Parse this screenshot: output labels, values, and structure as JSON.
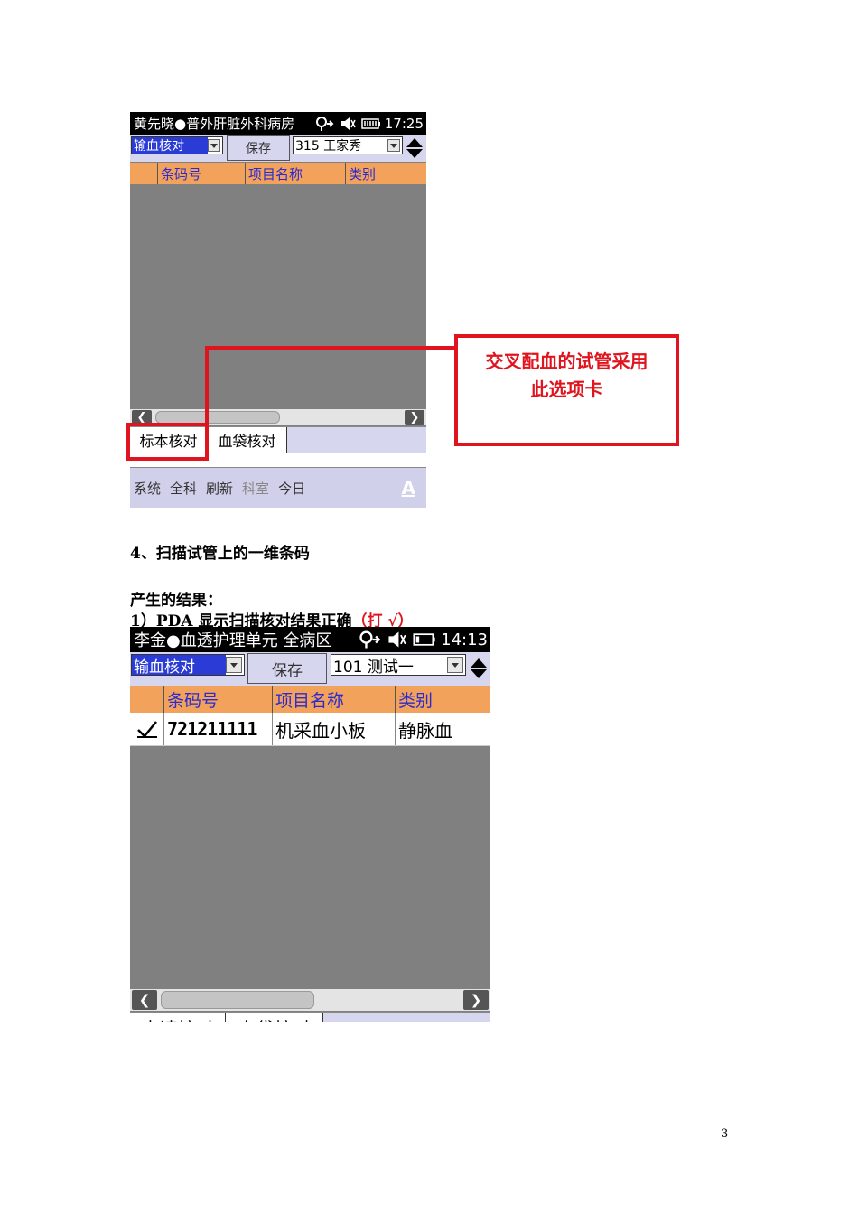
{
  "screen1": {
    "status": {
      "title": "黄先晓●普外肝脏外科病房",
      "time": "17:25"
    },
    "toolbar": {
      "dropdown_label": "输血核对",
      "save_label": "保存",
      "patient_select": "315 王家秀"
    },
    "table": {
      "headers": [
        "条码号",
        "项目名称",
        "类别"
      ]
    },
    "tabs": [
      "标本核对",
      "血袋核对"
    ],
    "menu": [
      "系统",
      "全科",
      "刷新",
      "科室",
      "今日"
    ],
    "menu_disabled": [
      "科室"
    ],
    "keyboard_glyph": "A"
  },
  "callout": {
    "line1": "交叉配血的试管采用",
    "line2": "此选项卡"
  },
  "doc": {
    "step_heading": "4、扫描试管上的一维条码",
    "result_heading": "产生的结果：",
    "result_item_prefix": "1）PDA 显示扫描核对结果正确",
    "result_item_mark": "（打 √）"
  },
  "screen2": {
    "status": {
      "title": "李金●血透护理单元 全病区",
      "time": "14:13"
    },
    "toolbar": {
      "dropdown_label": "输血核对",
      "save_label": "保存",
      "patient_select": "101 测试一"
    },
    "table": {
      "headers": [
        "条码号",
        "项目名称",
        "类别"
      ],
      "rows": [
        {
          "checked": true,
          "barcode": "721211111",
          "item": "机采血小板",
          "category": "静脉血"
        }
      ]
    },
    "tabs": [
      "申请核对",
      "血袋核对"
    ]
  },
  "page_number": "3",
  "colors": {
    "callout_red": "#e0141e",
    "header_orange": "#f2a25a",
    "header_text": "#2b2bd0",
    "select_blue": "#2a3bd6",
    "toolbar_bg": "#d6d6ee",
    "list_bg": "#808080"
  }
}
